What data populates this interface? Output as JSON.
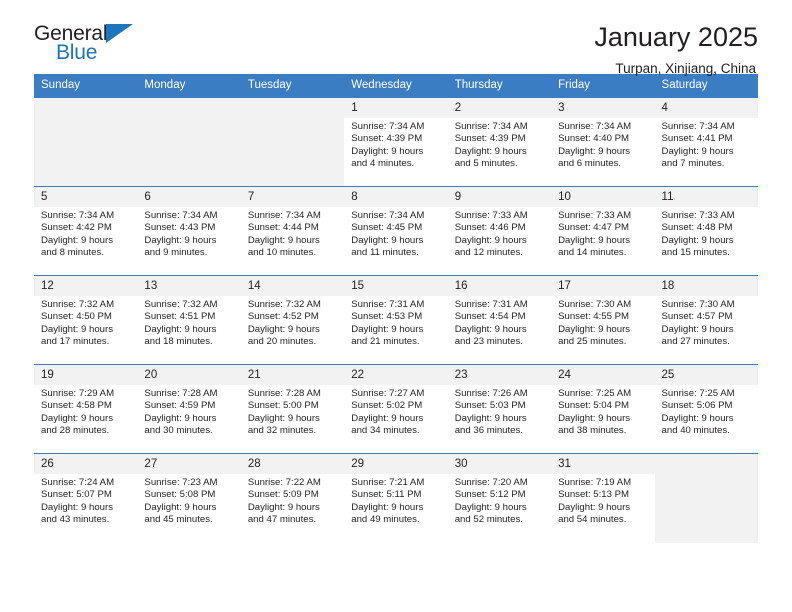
{
  "brand": {
    "name_top": "General",
    "name_bottom": "Blue",
    "accent_color": "#1b76bc"
  },
  "header": {
    "title": "January 2025",
    "location": "Turpan, Xinjiang, China"
  },
  "theme": {
    "header_blue": "#3b7dc3",
    "cell_band_gray": "#f2f2f2",
    "text_color": "#231f20"
  },
  "labels": {
    "sunrise_prefix": "Sunrise:",
    "sunset_prefix": "Sunset:",
    "daylight_prefix": "Daylight:"
  },
  "weekdays": [
    "Sunday",
    "Monday",
    "Tuesday",
    "Wednesday",
    "Thursday",
    "Friday",
    "Saturday"
  ],
  "weeks": [
    [
      {
        "empty": true
      },
      {
        "empty": true
      },
      {
        "empty": true
      },
      {
        "day": "1",
        "sunrise": "Sunrise: 7:34 AM",
        "sunset": "Sunset: 4:39 PM",
        "daylight_l1": "Daylight: 9 hours",
        "daylight_l2": "and 4 minutes."
      },
      {
        "day": "2",
        "sunrise": "Sunrise: 7:34 AM",
        "sunset": "Sunset: 4:39 PM",
        "daylight_l1": "Daylight: 9 hours",
        "daylight_l2": "and 5 minutes."
      },
      {
        "day": "3",
        "sunrise": "Sunrise: 7:34 AM",
        "sunset": "Sunset: 4:40 PM",
        "daylight_l1": "Daylight: 9 hours",
        "daylight_l2": "and 6 minutes."
      },
      {
        "day": "4",
        "sunrise": "Sunrise: 7:34 AM",
        "sunset": "Sunset: 4:41 PM",
        "daylight_l1": "Daylight: 9 hours",
        "daylight_l2": "and 7 minutes."
      }
    ],
    [
      {
        "day": "5",
        "sunrise": "Sunrise: 7:34 AM",
        "sunset": "Sunset: 4:42 PM",
        "daylight_l1": "Daylight: 9 hours",
        "daylight_l2": "and 8 minutes."
      },
      {
        "day": "6",
        "sunrise": "Sunrise: 7:34 AM",
        "sunset": "Sunset: 4:43 PM",
        "daylight_l1": "Daylight: 9 hours",
        "daylight_l2": "and 9 minutes."
      },
      {
        "day": "7",
        "sunrise": "Sunrise: 7:34 AM",
        "sunset": "Sunset: 4:44 PM",
        "daylight_l1": "Daylight: 9 hours",
        "daylight_l2": "and 10 minutes."
      },
      {
        "day": "8",
        "sunrise": "Sunrise: 7:34 AM",
        "sunset": "Sunset: 4:45 PM",
        "daylight_l1": "Daylight: 9 hours",
        "daylight_l2": "and 11 minutes."
      },
      {
        "day": "9",
        "sunrise": "Sunrise: 7:33 AM",
        "sunset": "Sunset: 4:46 PM",
        "daylight_l1": "Daylight: 9 hours",
        "daylight_l2": "and 12 minutes."
      },
      {
        "day": "10",
        "sunrise": "Sunrise: 7:33 AM",
        "sunset": "Sunset: 4:47 PM",
        "daylight_l1": "Daylight: 9 hours",
        "daylight_l2": "and 14 minutes."
      },
      {
        "day": "11",
        "sunrise": "Sunrise: 7:33 AM",
        "sunset": "Sunset: 4:48 PM",
        "daylight_l1": "Daylight: 9 hours",
        "daylight_l2": "and 15 minutes."
      }
    ],
    [
      {
        "day": "12",
        "sunrise": "Sunrise: 7:32 AM",
        "sunset": "Sunset: 4:50 PM",
        "daylight_l1": "Daylight: 9 hours",
        "daylight_l2": "and 17 minutes."
      },
      {
        "day": "13",
        "sunrise": "Sunrise: 7:32 AM",
        "sunset": "Sunset: 4:51 PM",
        "daylight_l1": "Daylight: 9 hours",
        "daylight_l2": "and 18 minutes."
      },
      {
        "day": "14",
        "sunrise": "Sunrise: 7:32 AM",
        "sunset": "Sunset: 4:52 PM",
        "daylight_l1": "Daylight: 9 hours",
        "daylight_l2": "and 20 minutes."
      },
      {
        "day": "15",
        "sunrise": "Sunrise: 7:31 AM",
        "sunset": "Sunset: 4:53 PM",
        "daylight_l1": "Daylight: 9 hours",
        "daylight_l2": "and 21 minutes."
      },
      {
        "day": "16",
        "sunrise": "Sunrise: 7:31 AM",
        "sunset": "Sunset: 4:54 PM",
        "daylight_l1": "Daylight: 9 hours",
        "daylight_l2": "and 23 minutes."
      },
      {
        "day": "17",
        "sunrise": "Sunrise: 7:30 AM",
        "sunset": "Sunset: 4:55 PM",
        "daylight_l1": "Daylight: 9 hours",
        "daylight_l2": "and 25 minutes."
      },
      {
        "day": "18",
        "sunrise": "Sunrise: 7:30 AM",
        "sunset": "Sunset: 4:57 PM",
        "daylight_l1": "Daylight: 9 hours",
        "daylight_l2": "and 27 minutes."
      }
    ],
    [
      {
        "day": "19",
        "sunrise": "Sunrise: 7:29 AM",
        "sunset": "Sunset: 4:58 PM",
        "daylight_l1": "Daylight: 9 hours",
        "daylight_l2": "and 28 minutes."
      },
      {
        "day": "20",
        "sunrise": "Sunrise: 7:28 AM",
        "sunset": "Sunset: 4:59 PM",
        "daylight_l1": "Daylight: 9 hours",
        "daylight_l2": "and 30 minutes."
      },
      {
        "day": "21",
        "sunrise": "Sunrise: 7:28 AM",
        "sunset": "Sunset: 5:00 PM",
        "daylight_l1": "Daylight: 9 hours",
        "daylight_l2": "and 32 minutes."
      },
      {
        "day": "22",
        "sunrise": "Sunrise: 7:27 AM",
        "sunset": "Sunset: 5:02 PM",
        "daylight_l1": "Daylight: 9 hours",
        "daylight_l2": "and 34 minutes."
      },
      {
        "day": "23",
        "sunrise": "Sunrise: 7:26 AM",
        "sunset": "Sunset: 5:03 PM",
        "daylight_l1": "Daylight: 9 hours",
        "daylight_l2": "and 36 minutes."
      },
      {
        "day": "24",
        "sunrise": "Sunrise: 7:25 AM",
        "sunset": "Sunset: 5:04 PM",
        "daylight_l1": "Daylight: 9 hours",
        "daylight_l2": "and 38 minutes."
      },
      {
        "day": "25",
        "sunrise": "Sunrise: 7:25 AM",
        "sunset": "Sunset: 5:06 PM",
        "daylight_l1": "Daylight: 9 hours",
        "daylight_l2": "and 40 minutes."
      }
    ],
    [
      {
        "day": "26",
        "sunrise": "Sunrise: 7:24 AM",
        "sunset": "Sunset: 5:07 PM",
        "daylight_l1": "Daylight: 9 hours",
        "daylight_l2": "and 43 minutes."
      },
      {
        "day": "27",
        "sunrise": "Sunrise: 7:23 AM",
        "sunset": "Sunset: 5:08 PM",
        "daylight_l1": "Daylight: 9 hours",
        "daylight_l2": "and 45 minutes."
      },
      {
        "day": "28",
        "sunrise": "Sunrise: 7:22 AM",
        "sunset": "Sunset: 5:09 PM",
        "daylight_l1": "Daylight: 9 hours",
        "daylight_l2": "and 47 minutes."
      },
      {
        "day": "29",
        "sunrise": "Sunrise: 7:21 AM",
        "sunset": "Sunset: 5:11 PM",
        "daylight_l1": "Daylight: 9 hours",
        "daylight_l2": "and 49 minutes."
      },
      {
        "day": "30",
        "sunrise": "Sunrise: 7:20 AM",
        "sunset": "Sunset: 5:12 PM",
        "daylight_l1": "Daylight: 9 hours",
        "daylight_l2": "and 52 minutes."
      },
      {
        "day": "31",
        "sunrise": "Sunrise: 7:19 AM",
        "sunset": "Sunset: 5:13 PM",
        "daylight_l1": "Daylight: 9 hours",
        "daylight_l2": "and 54 minutes."
      },
      {
        "empty": true
      }
    ]
  ]
}
